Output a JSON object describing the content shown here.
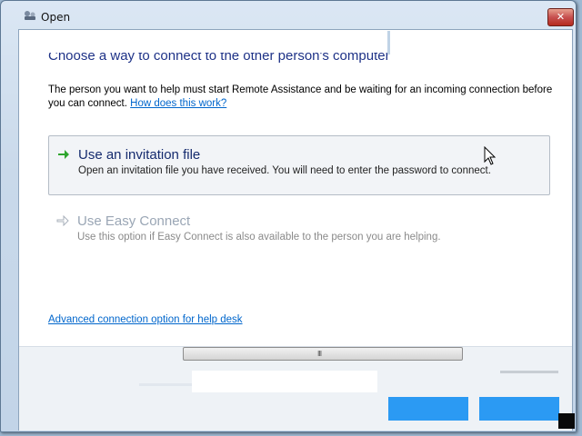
{
  "window": {
    "title": "Open",
    "close_symbol": "✕"
  },
  "heading": "Choose a way to connect to the other person's computer",
  "description": "The person you want to help must start Remote Assistance and be waiting for an incoming connection before you can connect.",
  "how_link": "How does this work?",
  "options": [
    {
      "title": "Use an invitation file",
      "desc": "Open an invitation file you have received.  You will need to enter the password to connect.",
      "icon": "green-arrow-icon",
      "enabled": true
    },
    {
      "title": "Use Easy Connect",
      "desc": "Use this option if Easy Connect is also available to the person you are helping.",
      "icon": "gray-arrow-icon",
      "enabled": false
    }
  ],
  "advanced_link": "Advanced connection option for help desk",
  "scrollbar_grip": "III",
  "colors": {
    "accent_blue": "#2b9af3",
    "heading_blue": "#1e3287",
    "link_blue": "#0066cc",
    "close_red": "#c75050"
  }
}
